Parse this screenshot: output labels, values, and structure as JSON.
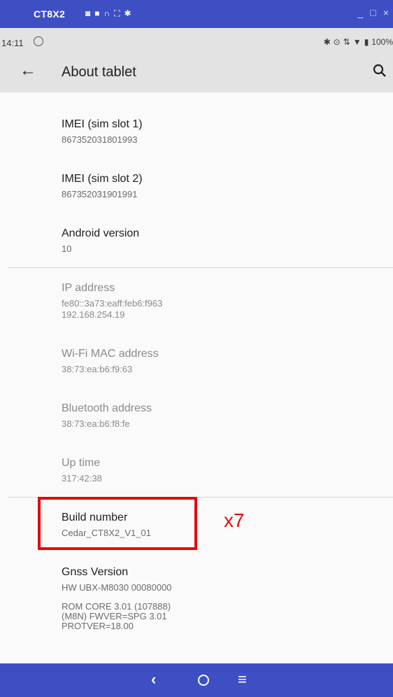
{
  "window": {
    "title": "CT8X2",
    "controls": [
      "_",
      "□",
      "×"
    ]
  },
  "status": {
    "time": "14:11",
    "battery": "100%"
  },
  "appbar": {
    "title": "About tablet"
  },
  "items": [
    {
      "title": "IMEI (sim slot 1)",
      "value": "867352031801993"
    },
    {
      "title": "IMEI (sim slot 2)",
      "value": "867352031901991"
    },
    {
      "title": "Android version",
      "value": "10"
    },
    {
      "title": "IP address",
      "value": "fe80::3a73:eaff:feb6:f963\n192.168.254.19"
    },
    {
      "title": "Wi-Fi MAC address",
      "value": "38:73:ea:b6:f9:63"
    },
    {
      "title": "Bluetooth address",
      "value": "38:73:ea:b6:f8:fe"
    },
    {
      "title": "Up time",
      "value": "317:42:38"
    },
    {
      "title": "Build number",
      "value": "Cedar_CT8X2_V1_01"
    },
    {
      "title": "Gnss Version",
      "value": "HW UBX-M8030 00080000"
    }
  ],
  "gnss_extra": "ROM CORE 3.01 (107888)\n(M8N) FWVER=SPG 3.01\nPROTVER=18.00",
  "annotation": {
    "label": "x7",
    "color": "#e8090a"
  },
  "colors": {
    "titlebar": "#3e4fc4",
    "navbar": "#3e4fc4",
    "appbar": "#e3e3e3",
    "highlight": "#e8090a"
  },
  "nav": {
    "back": "‹",
    "menu": "≡"
  }
}
